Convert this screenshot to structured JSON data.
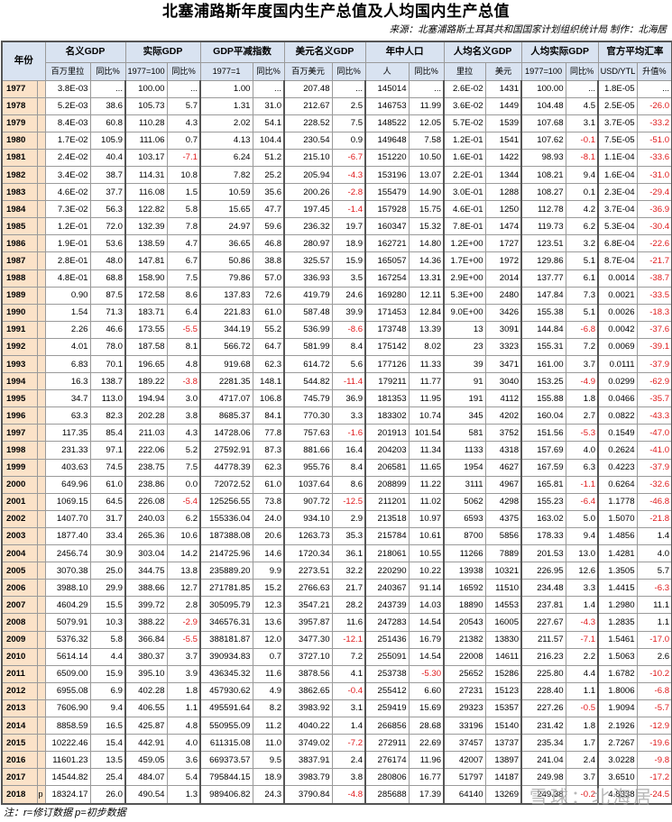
{
  "title": "北塞浦路斯年度国内生产总值及人均国内生产总值",
  "source": "来源：北塞浦路斯土耳其共和国国家计划组织统计局  制作：北海居",
  "header": {
    "year": "年份",
    "groups": [
      "名义GDP",
      "实际GDP",
      "GDP平减指数",
      "美元名义GDP",
      "年中人口",
      "人均名义GDP",
      "人均实际GDP",
      "官方平均汇率"
    ],
    "subs": [
      "百万里拉",
      "同比%",
      "1977=100",
      "同比%",
      "1977=1",
      "同比%",
      "百万美元",
      "同比%",
      "人",
      "同比%",
      "里拉",
      "美元",
      "1977=100",
      "同比%",
      "USD/YTL",
      "升值%"
    ]
  },
  "rows": [
    {
      "year": "1977",
      "flag": "",
      "v": [
        "3.8E-03",
        "...",
        "100.00",
        "...",
        "1.00",
        "...",
        "207.48",
        "...",
        "145014",
        "...",
        "2.6E-02",
        "1431",
        "100.00",
        "...",
        "1.8E-05",
        "..."
      ]
    },
    {
      "year": "1978",
      "flag": "",
      "v": [
        "5.2E-03",
        "38.6",
        "105.73",
        "5.7",
        "1.31",
        "31.0",
        "212.67",
        "2.5",
        "146753",
        "11.99",
        "3.6E-02",
        "1449",
        "104.48",
        "4.5",
        "2.5E-05",
        "-26.0"
      ]
    },
    {
      "year": "1979",
      "flag": "",
      "v": [
        "8.4E-03",
        "60.8",
        "110.28",
        "4.3",
        "2.02",
        "54.1",
        "228.52",
        "7.5",
        "148522",
        "12.05",
        "5.7E-02",
        "1539",
        "107.68",
        "3.1",
        "3.7E-05",
        "-33.2"
      ]
    },
    {
      "year": "1980",
      "flag": "",
      "v": [
        "1.7E-02",
        "105.9",
        "111.06",
        "0.7",
        "4.13",
        "104.4",
        "230.54",
        "0.9",
        "149648",
        "7.58",
        "1.2E-01",
        "1541",
        "107.62",
        "-0.1",
        "7.5E-05",
        "-51.0"
      ]
    },
    {
      "year": "1981",
      "flag": "",
      "v": [
        "2.4E-02",
        "40.4",
        "103.17",
        "-7.1",
        "6.24",
        "51.2",
        "215.10",
        "-6.7",
        "151220",
        "10.50",
        "1.6E-01",
        "1422",
        "98.93",
        "-8.1",
        "1.1E-04",
        "-33.6"
      ]
    },
    {
      "year": "1982",
      "flag": "",
      "v": [
        "3.4E-02",
        "38.7",
        "114.31",
        "10.8",
        "7.82",
        "25.2",
        "205.94",
        "-4.3",
        "153196",
        "13.07",
        "2.2E-01",
        "1344",
        "108.21",
        "9.4",
        "1.6E-04",
        "-31.0"
      ]
    },
    {
      "year": "1983",
      "flag": "",
      "v": [
        "4.6E-02",
        "37.7",
        "116.08",
        "1.5",
        "10.59",
        "35.6",
        "200.26",
        "-2.8",
        "155479",
        "14.90",
        "3.0E-01",
        "1288",
        "108.27",
        "0.1",
        "2.3E-04",
        "-29.4"
      ]
    },
    {
      "year": "1984",
      "flag": "",
      "v": [
        "7.3E-02",
        "56.3",
        "122.82",
        "5.8",
        "15.65",
        "47.7",
        "197.45",
        "-1.4",
        "157928",
        "15.75",
        "4.6E-01",
        "1250",
        "112.78",
        "4.2",
        "3.7E-04",
        "-36.9"
      ]
    },
    {
      "year": "1985",
      "flag": "",
      "v": [
        "1.2E-01",
        "72.0",
        "132.39",
        "7.8",
        "24.97",
        "59.6",
        "236.32",
        "19.7",
        "160347",
        "15.32",
        "7.8E-01",
        "1474",
        "119.73",
        "6.2",
        "5.3E-04",
        "-30.4"
      ]
    },
    {
      "year": "1986",
      "flag": "",
      "v": [
        "1.9E-01",
        "53.6",
        "138.59",
        "4.7",
        "36.65",
        "46.8",
        "280.97",
        "18.9",
        "162721",
        "14.80",
        "1.2E+00",
        "1727",
        "123.51",
        "3.2",
        "6.8E-04",
        "-22.6"
      ]
    },
    {
      "year": "1987",
      "flag": "",
      "v": [
        "2.8E-01",
        "48.0",
        "147.81",
        "6.7",
        "50.86",
        "38.8",
        "325.57",
        "15.9",
        "165057",
        "14.36",
        "1.7E+00",
        "1972",
        "129.86",
        "5.1",
        "8.7E-04",
        "-21.7"
      ]
    },
    {
      "year": "1988",
      "flag": "",
      "v": [
        "4.8E-01",
        "68.8",
        "158.90",
        "7.5",
        "79.86",
        "57.0",
        "336.93",
        "3.5",
        "167254",
        "13.31",
        "2.9E+00",
        "2014",
        "137.77",
        "6.1",
        "0.0014",
        "-38.7"
      ]
    },
    {
      "year": "1989",
      "flag": "",
      "v": [
        "0.90",
        "87.5",
        "172.58",
        "8.6",
        "137.83",
        "72.6",
        "419.79",
        "24.6",
        "169280",
        "12.11",
        "5.3E+00",
        "2480",
        "147.84",
        "7.3",
        "0.0021",
        "-33.5"
      ]
    },
    {
      "year": "1990",
      "flag": "",
      "v": [
        "1.54",
        "71.3",
        "183.71",
        "6.4",
        "221.83",
        "61.0",
        "587.48",
        "39.9",
        "171453",
        "12.84",
        "9.0E+00",
        "3426",
        "155.38",
        "5.1",
        "0.0026",
        "-18.3"
      ]
    },
    {
      "year": "1991",
      "flag": "",
      "v": [
        "2.26",
        "46.6",
        "173.55",
        "-5.5",
        "344.19",
        "55.2",
        "536.99",
        "-8.6",
        "173748",
        "13.39",
        "13",
        "3091",
        "144.84",
        "-6.8",
        "0.0042",
        "-37.6"
      ]
    },
    {
      "year": "1992",
      "flag": "",
      "v": [
        "4.01",
        "78.0",
        "187.58",
        "8.1",
        "566.72",
        "64.7",
        "581.99",
        "8.4",
        "175142",
        "8.02",
        "23",
        "3323",
        "155.31",
        "7.2",
        "0.0069",
        "-39.1"
      ]
    },
    {
      "year": "1993",
      "flag": "",
      "v": [
        "6.83",
        "70.1",
        "196.65",
        "4.8",
        "919.68",
        "62.3",
        "614.72",
        "5.6",
        "177126",
        "11.33",
        "39",
        "3471",
        "161.00",
        "3.7",
        "0.0111",
        "-37.9"
      ]
    },
    {
      "year": "1994",
      "flag": "",
      "v": [
        "16.3",
        "138.7",
        "189.22",
        "-3.8",
        "2281.35",
        "148.1",
        "544.82",
        "-11.4",
        "179211",
        "11.77",
        "91",
        "3040",
        "153.25",
        "-4.9",
        "0.0299",
        "-62.9"
      ]
    },
    {
      "year": "1995",
      "flag": "",
      "v": [
        "34.7",
        "113.0",
        "194.94",
        "3.0",
        "4717.07",
        "106.8",
        "745.79",
        "36.9",
        "181353",
        "11.95",
        "191",
        "4112",
        "155.88",
        "1.8",
        "0.0466",
        "-35.7"
      ]
    },
    {
      "year": "1996",
      "flag": "",
      "v": [
        "63.3",
        "82.3",
        "202.28",
        "3.8",
        "8685.37",
        "84.1",
        "770.30",
        "3.3",
        "183302",
        "10.74",
        "345",
        "4202",
        "160.04",
        "2.7",
        "0.0822",
        "-43.3"
      ]
    },
    {
      "year": "1997",
      "flag": "",
      "v": [
        "117.35",
        "85.4",
        "211.03",
        "4.3",
        "14728.06",
        "77.8",
        "757.63",
        "-1.6",
        "201913",
        "101.54",
        "581",
        "3752",
        "151.56",
        "-5.3",
        "0.1549",
        "-47.0"
      ]
    },
    {
      "year": "1998",
      "flag": "",
      "v": [
        "231.33",
        "97.1",
        "222.06",
        "5.2",
        "27592.91",
        "87.3",
        "881.66",
        "16.4",
        "204203",
        "11.34",
        "1133",
        "4318",
        "157.69",
        "4.0",
        "0.2624",
        "-41.0"
      ]
    },
    {
      "year": "1999",
      "flag": "",
      "v": [
        "403.63",
        "74.5",
        "238.75",
        "7.5",
        "44778.39",
        "62.3",
        "955.76",
        "8.4",
        "206581",
        "11.65",
        "1954",
        "4627",
        "167.59",
        "6.3",
        "0.4223",
        "-37.9"
      ]
    },
    {
      "year": "2000",
      "flag": "",
      "v": [
        "649.96",
        "61.0",
        "238.86",
        "0.0",
        "72072.52",
        "61.0",
        "1037.64",
        "8.6",
        "208899",
        "11.22",
        "3111",
        "4967",
        "165.81",
        "-1.1",
        "0.6264",
        "-32.6"
      ]
    },
    {
      "year": "2001",
      "flag": "",
      "v": [
        "1069.15",
        "64.5",
        "226.08",
        "-5.4",
        "125256.55",
        "73.8",
        "907.72",
        "-12.5",
        "211201",
        "11.02",
        "5062",
        "4298",
        "155.23",
        "-6.4",
        "1.1778",
        "-46.8"
      ]
    },
    {
      "year": "2002",
      "flag": "",
      "v": [
        "1407.70",
        "31.7",
        "240.03",
        "6.2",
        "155336.04",
        "24.0",
        "934.10",
        "2.9",
        "213518",
        "10.97",
        "6593",
        "4375",
        "163.02",
        "5.0",
        "1.5070",
        "-21.8"
      ]
    },
    {
      "year": "2003",
      "flag": "",
      "v": [
        "1877.40",
        "33.4",
        "265.36",
        "10.6",
        "187388.08",
        "20.6",
        "1263.73",
        "35.3",
        "215784",
        "10.61",
        "8700",
        "5856",
        "178.33",
        "9.4",
        "1.4856",
        "1.4"
      ]
    },
    {
      "year": "2004",
      "flag": "",
      "v": [
        "2456.74",
        "30.9",
        "303.04",
        "14.2",
        "214725.96",
        "14.6",
        "1720.34",
        "36.1",
        "218061",
        "10.55",
        "11266",
        "7889",
        "201.53",
        "13.0",
        "1.4281",
        "4.0"
      ]
    },
    {
      "year": "2005",
      "flag": "",
      "v": [
        "3070.38",
        "25.0",
        "344.75",
        "13.8",
        "235889.20",
        "9.9",
        "2273.51",
        "32.2",
        "220290",
        "10.22",
        "13938",
        "10321",
        "226.95",
        "12.6",
        "1.3505",
        "5.7"
      ]
    },
    {
      "year": "2006",
      "flag": "",
      "v": [
        "3988.10",
        "29.9",
        "388.66",
        "12.7",
        "271781.85",
        "15.2",
        "2766.63",
        "21.7",
        "240367",
        "91.14",
        "16592",
        "11510",
        "234.48",
        "3.3",
        "1.4415",
        "-6.3"
      ]
    },
    {
      "year": "2007",
      "flag": "",
      "v": [
        "4604.29",
        "15.5",
        "399.72",
        "2.8",
        "305095.79",
        "12.3",
        "3547.21",
        "28.2",
        "243739",
        "14.03",
        "18890",
        "14553",
        "237.81",
        "1.4",
        "1.2980",
        "11.1"
      ]
    },
    {
      "year": "2008",
      "flag": "",
      "v": [
        "5079.91",
        "10.3",
        "388.22",
        "-2.9",
        "346576.31",
        "13.6",
        "3957.87",
        "11.6",
        "247283",
        "14.54",
        "20543",
        "16005",
        "227.67",
        "-4.3",
        "1.2835",
        "1.1"
      ]
    },
    {
      "year": "2009",
      "flag": "",
      "v": [
        "5376.32",
        "5.8",
        "366.84",
        "-5.5",
        "388181.87",
        "12.0",
        "3477.30",
        "-12.1",
        "251436",
        "16.79",
        "21382",
        "13830",
        "211.57",
        "-7.1",
        "1.5461",
        "-17.0"
      ]
    },
    {
      "year": "2010",
      "flag": "",
      "v": [
        "5614.14",
        "4.4",
        "380.37",
        "3.7",
        "390934.83",
        "0.7",
        "3727.10",
        "7.2",
        "255091",
        "14.54",
        "22008",
        "14611",
        "216.23",
        "2.2",
        "1.5063",
        "2.6"
      ]
    },
    {
      "year": "2011",
      "flag": "",
      "v": [
        "6509.00",
        "15.9",
        "395.10",
        "3.9",
        "436345.32",
        "11.6",
        "3878.56",
        "4.1",
        "253738",
        "-5.30",
        "25652",
        "15286",
        "225.80",
        "4.4",
        "1.6782",
        "-10.2"
      ]
    },
    {
      "year": "2012",
      "flag": "",
      "v": [
        "6955.08",
        "6.9",
        "402.28",
        "1.8",
        "457930.62",
        "4.9",
        "3862.65",
        "-0.4",
        "255412",
        "6.60",
        "27231",
        "15123",
        "228.40",
        "1.1",
        "1.8006",
        "-6.8"
      ]
    },
    {
      "year": "2013",
      "flag": "",
      "v": [
        "7606.90",
        "9.4",
        "406.55",
        "1.1",
        "495591.64",
        "8.2",
        "3983.92",
        "3.1",
        "259419",
        "15.69",
        "29323",
        "15357",
        "227.26",
        "-0.5",
        "1.9094",
        "-5.7"
      ]
    },
    {
      "year": "2014",
      "flag": "",
      "v": [
        "8858.59",
        "16.5",
        "425.87",
        "4.8",
        "550955.09",
        "11.2",
        "4040.22",
        "1.4",
        "266856",
        "28.68",
        "33196",
        "15140",
        "231.42",
        "1.8",
        "2.1926",
        "-12.9"
      ]
    },
    {
      "year": "2015",
      "flag": "",
      "v": [
        "10222.46",
        "15.4",
        "442.91",
        "4.0",
        "611315.08",
        "11.0",
        "3749.02",
        "-7.2",
        "272911",
        "22.69",
        "37457",
        "13737",
        "235.34",
        "1.7",
        "2.7267",
        "-19.6"
      ]
    },
    {
      "year": "2016",
      "flag": "",
      "v": [
        "11601.23",
        "13.5",
        "459.05",
        "3.6",
        "669373.57",
        "9.5",
        "3837.91",
        "2.4",
        "276174",
        "11.96",
        "42007",
        "13897",
        "241.04",
        "2.4",
        "3.0228",
        "-9.8"
      ]
    },
    {
      "year": "2017",
      "flag": "",
      "v": [
        "14544.82",
        "25.4",
        "484.07",
        "5.4",
        "795844.15",
        "18.9",
        "3983.79",
        "3.8",
        "280806",
        "16.77",
        "51797",
        "14187",
        "249.98",
        "3.7",
        "3.6510",
        "-17.2"
      ]
    },
    {
      "year": "2018",
      "flag": "p",
      "v": [
        "18324.17",
        "26.0",
        "490.54",
        "1.3",
        "989406.82",
        "24.3",
        "3790.84",
        "-4.8",
        "285688",
        "17.39",
        "64140",
        "13269",
        "249.38",
        "-0.2",
        "4.8338",
        "-24.5"
      ]
    }
  ],
  "note": "注：r=修订数据 p=初步数据",
  "watermark": "雪球：北海居"
}
